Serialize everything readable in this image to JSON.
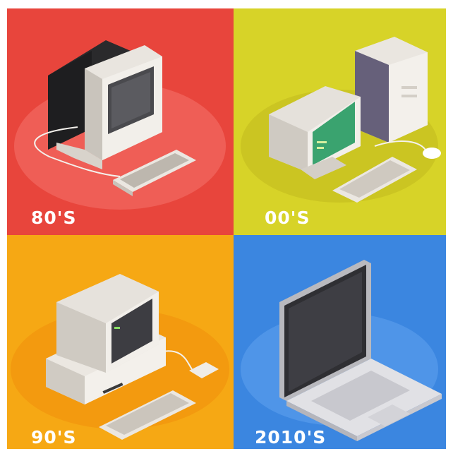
{
  "tiles": [
    {
      "era": "80'S",
      "bg": "#e8453c",
      "glow": "#ef5e56",
      "computer": "retro-80s-computer"
    },
    {
      "era": "00'S",
      "bg": "#d7d328",
      "glow": "#cbc522",
      "computer": "desktop-tower-computer"
    },
    {
      "era": "90'S",
      "bg": "#f6a814",
      "glow": "#f39a0f",
      "computer": "beige-90s-computer"
    },
    {
      "era": "2010'S",
      "bg": "#3b86e0",
      "glow": "#4f95e8",
      "computer": "laptop"
    }
  ]
}
